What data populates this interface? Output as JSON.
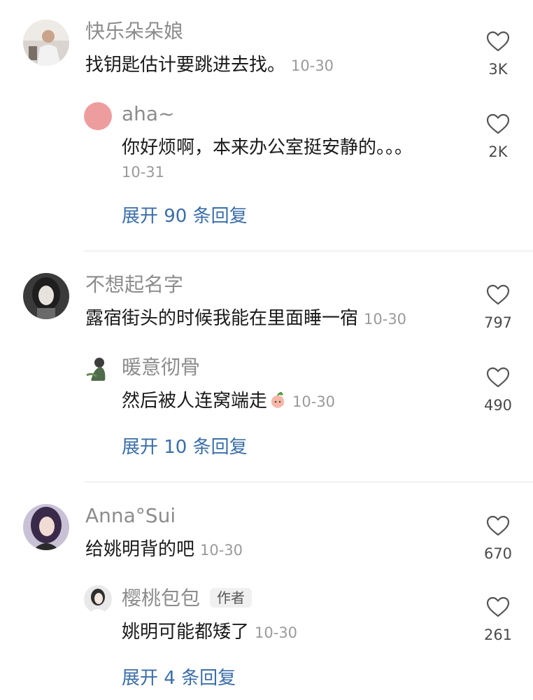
{
  "threads": [
    {
      "comment": {
        "username": "快乐朵朵娘",
        "text": "找钥匙估计要跳进去找。",
        "time": "10-30",
        "likes": "3K"
      },
      "reply": {
        "username": "aha~",
        "text": "你好烦啊，本来办公室挺安静的。。。",
        "time": "10-31",
        "likes": "2K"
      },
      "expand_label": "展开 90 条回复"
    },
    {
      "comment": {
        "username": "不想起名字",
        "text": "露宿街头的时候我能在里面睡一宿",
        "time": "10-30",
        "likes": "797"
      },
      "reply": {
        "username": "暖意彻骨",
        "text": "然后被人连窝端走",
        "time": "10-30",
        "likes": "490"
      },
      "expand_label": "展开 10 条回复"
    },
    {
      "comment": {
        "username": "Anna°Sui",
        "text": "给姚明背的吧",
        "time": "10-30",
        "likes": "670"
      },
      "reply": {
        "username": "樱桃包包",
        "badge": "作者",
        "text": "姚明可能都矮了",
        "time": "10-30",
        "likes": "261"
      },
      "expand_label": "展开 4 条回复"
    }
  ],
  "icons": {
    "like": "heart-outline-icon",
    "emoji": "peach-emoji-icon"
  },
  "colors": {
    "username": "#8c8c8c",
    "content": "#1a1a1a",
    "time": "#9a9a9a",
    "expand_link": "#3b6ea8",
    "divider": "#e6e6e6"
  }
}
